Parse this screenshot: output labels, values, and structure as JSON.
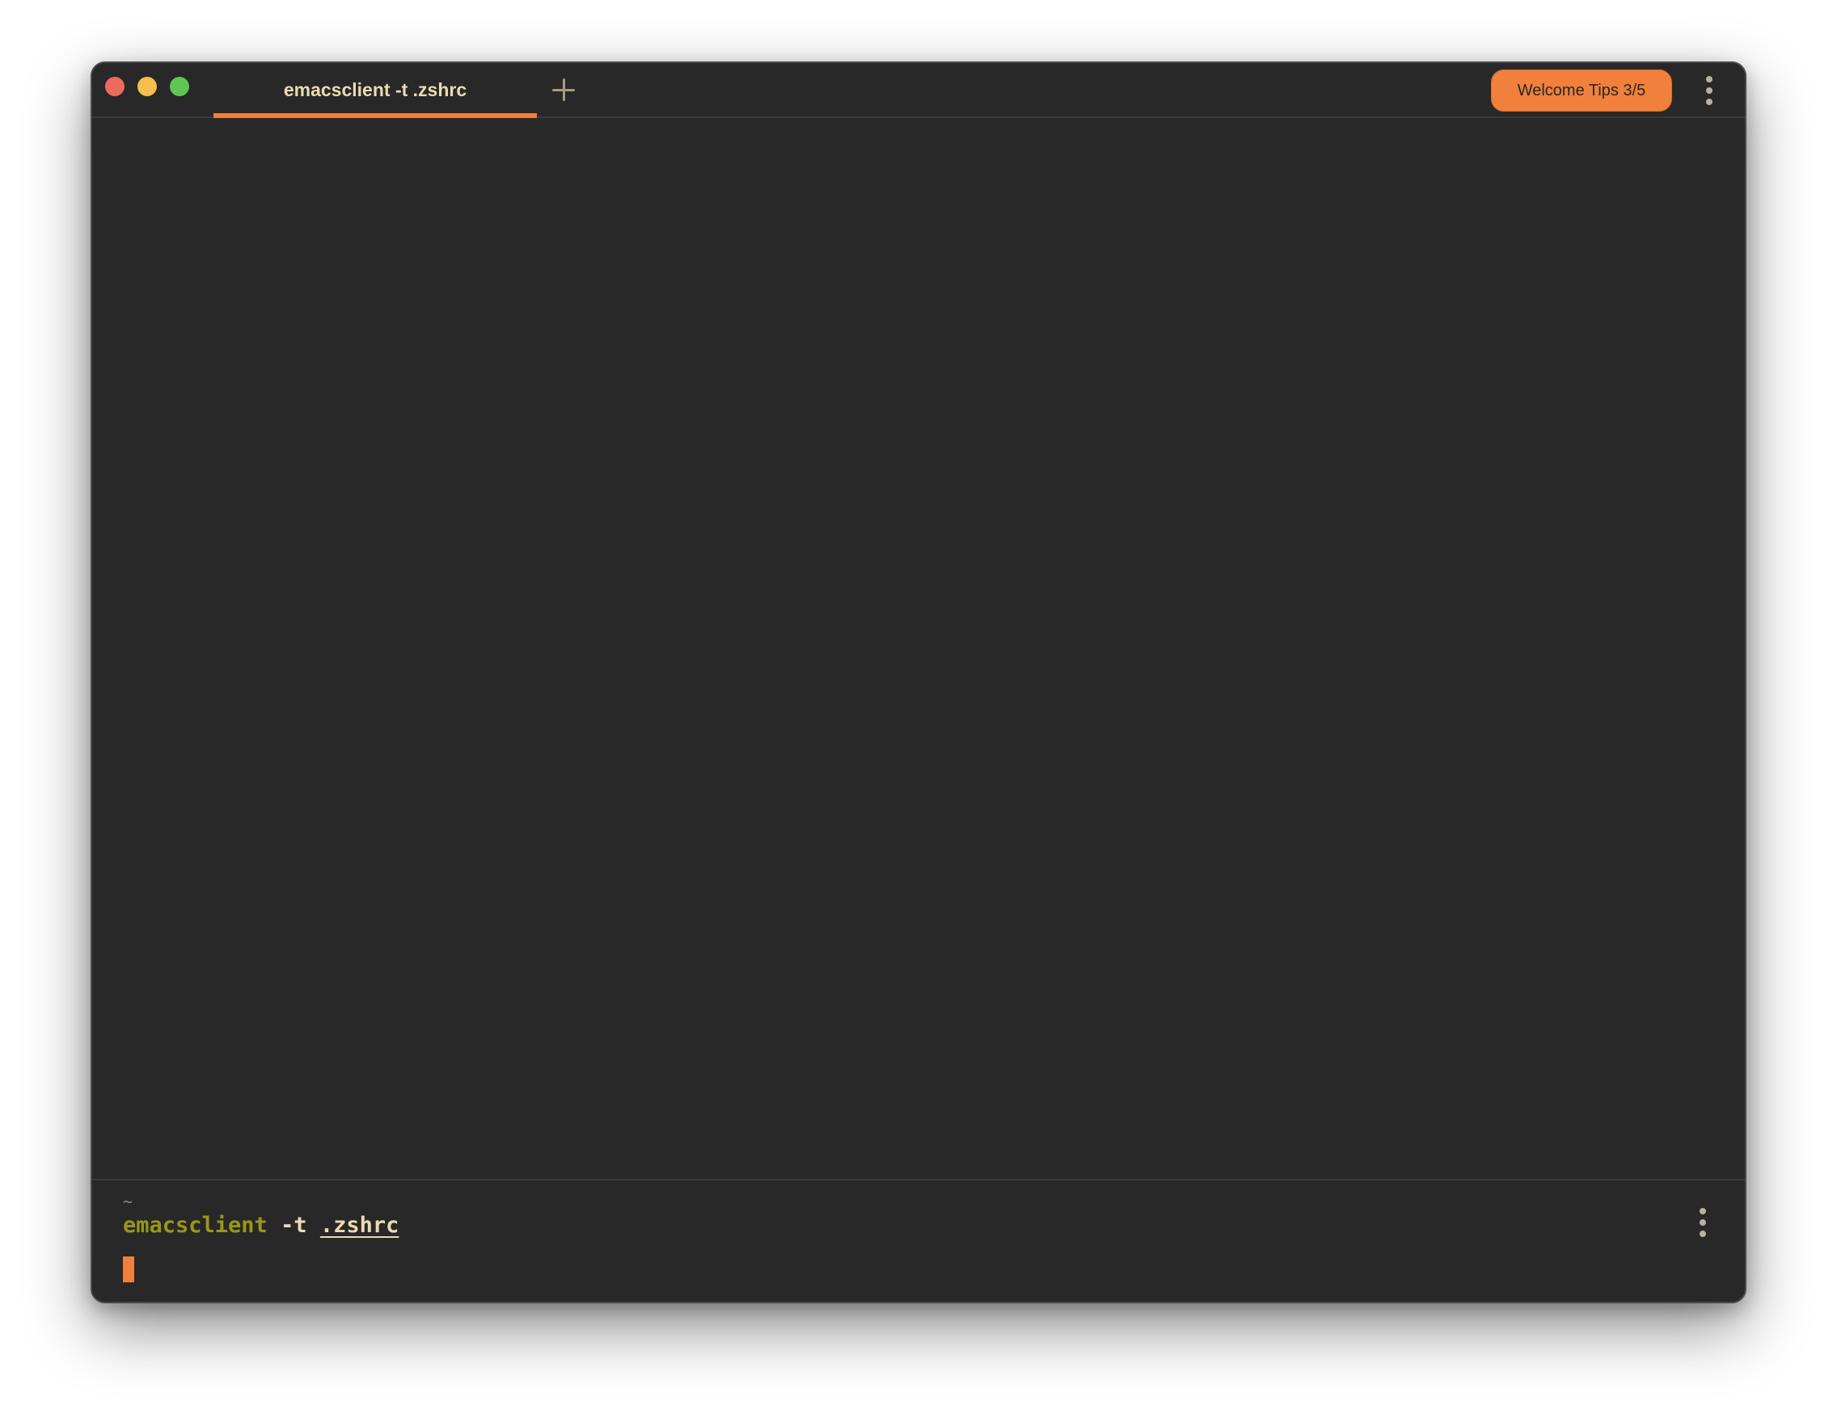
{
  "window": {
    "traffic_lights": {
      "close_color": "#ed6a5e",
      "minimize_color": "#f4bf4f",
      "maximize_color": "#61c554"
    }
  },
  "tabs": [
    {
      "label": "emacsclient -t .zshrc",
      "active": true
    }
  ],
  "toolbar": {
    "new_tab_icon": "plus-icon",
    "welcome_tips_label": "Welcome Tips 3/5",
    "menu_icon": "kebab-menu-icon"
  },
  "terminal": {
    "block": {
      "cwd": "~",
      "command": {
        "name": "emacsclient",
        "flag": "-t",
        "argument": ".zshrc"
      },
      "menu_icon": "kebab-menu-icon"
    },
    "cursor_color": "#f0803c"
  },
  "colors": {
    "accent": "#f0803c",
    "background": "#282828",
    "command_name": "#98971a",
    "text": "#ebdbb2"
  }
}
